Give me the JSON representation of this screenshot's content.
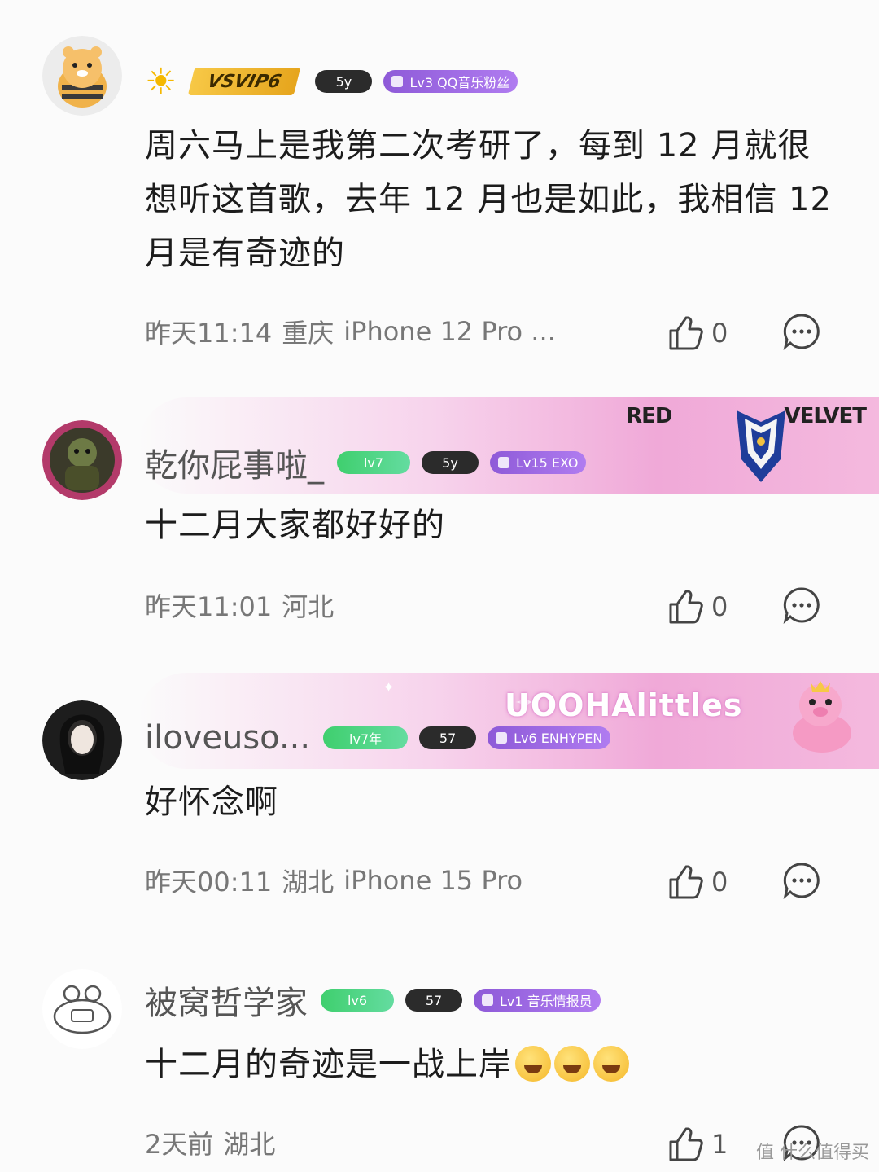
{
  "comments": [
    {
      "username": "",
      "svip": "VSVIP6",
      "badges": {
        "years": "5y",
        "fan": "Lv3 QQ音乐粉丝"
      },
      "text": "周六马上是我第二次考研了，每到 12 月就很想听这首歌，去年 12 月也是如此，我相信 12 月是有奇迹的",
      "time": "昨天11:14",
      "location": "重庆",
      "device": "iPhone 12 Pro ...",
      "likes": "0"
    },
    {
      "username": "乾你屁事啦_",
      "badges": {
        "level": "lv7",
        "years": "5y",
        "fan": "Lv15 EXO"
      },
      "banner": {
        "left": "RED",
        "right": "VELVET"
      },
      "text": "十二月大家都好好的",
      "time": "昨天11:01",
      "location": "河北",
      "device": "",
      "likes": "0"
    },
    {
      "username": "iloveuso...",
      "badges": {
        "level": "lv7年",
        "years": "57",
        "fan": "Lv6 ENHYPEN"
      },
      "banner": {
        "text": "UOOHAlittles"
      },
      "text": "好怀念啊",
      "time": "昨天00:11",
      "location": "湖北",
      "device": "iPhone 15 Pro",
      "likes": "0"
    },
    {
      "username": "被窝哲学家",
      "badges": {
        "level": "lv6",
        "years": "57",
        "fan": "Lv1 音乐情报员"
      },
      "text": "十二月的奇迹是一战上岸",
      "time": "2天前",
      "location": "湖北",
      "device": "",
      "likes": "1"
    }
  ],
  "watermark": "值 什么值得买",
  "icons": [
    "thumbs-up-icon",
    "reply-bubble-icon",
    "sun-icon"
  ]
}
